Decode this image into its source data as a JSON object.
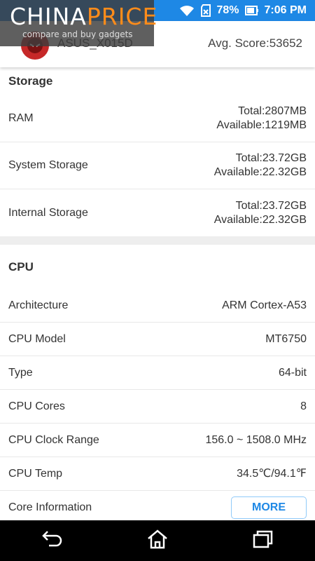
{
  "status_bar": {
    "battery_percent": "78%",
    "time": "7:06 PM",
    "icons": [
      "wifi-icon",
      "sd-card-icon",
      "battery-icon"
    ]
  },
  "watermark": {
    "brand_main": "CHINA",
    "brand_accent": "PRICE",
    "tagline": "compare and buy gadgets"
  },
  "header": {
    "device_name": "ASUS_X015D",
    "avg_score": "Avg. Score:53652"
  },
  "storage": {
    "title": "Storage",
    "rows": [
      {
        "label": "RAM",
        "value_line1": "Total:2807MB",
        "value_line2": "Available:1219MB"
      },
      {
        "label": "System Storage",
        "value_line1": "Total:23.72GB",
        "value_line2": "Available:22.32GB"
      },
      {
        "label": "Internal Storage",
        "value_line1": "Total:23.72GB",
        "value_line2": "Available:22.32GB"
      }
    ]
  },
  "cpu": {
    "title": "CPU",
    "rows": [
      {
        "label": "Architecture",
        "value": "ARM Cortex-A53"
      },
      {
        "label": "CPU Model",
        "value": "MT6750"
      },
      {
        "label": "Type",
        "value": "64-bit"
      },
      {
        "label": "CPU Cores",
        "value": "8"
      },
      {
        "label": "CPU Clock Range",
        "value": "156.0 ~ 1508.0 MHz"
      },
      {
        "label": "CPU Temp",
        "value": "34.5℃/94.1℉"
      }
    ],
    "core_info_label": "Core Information",
    "more_button": "MORE"
  },
  "colors": {
    "status_bar": "#1e88e5",
    "accent_blue": "#1e88e5",
    "watermark_orange": "#ff8c1a"
  },
  "nav": {
    "icons": [
      "back-icon",
      "home-icon",
      "recents-icon"
    ]
  }
}
